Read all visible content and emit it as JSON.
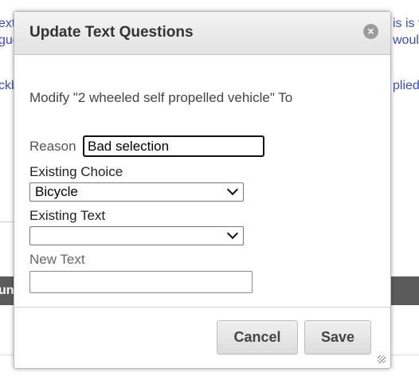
{
  "background": {
    "left_fragments": [
      "ext",
      "gue",
      "ckb"
    ],
    "right_fragments": [
      "is is v",
      "would",
      "plied"
    ],
    "band_text": "unt"
  },
  "dialog": {
    "title": "Update Text Questions",
    "close_glyph": "×",
    "prompt": "Modify \"2 wheeled self propelled vehicle\" To",
    "reason": {
      "label": "Reason",
      "value": "Bad selection"
    },
    "existing_choice": {
      "label": "Existing Choice",
      "selected": "Bicycle"
    },
    "existing_text": {
      "label": "Existing Text",
      "selected": ""
    },
    "new_text": {
      "label": "New Text",
      "value": ""
    },
    "buttons": {
      "cancel": "Cancel",
      "save": "Save"
    }
  }
}
